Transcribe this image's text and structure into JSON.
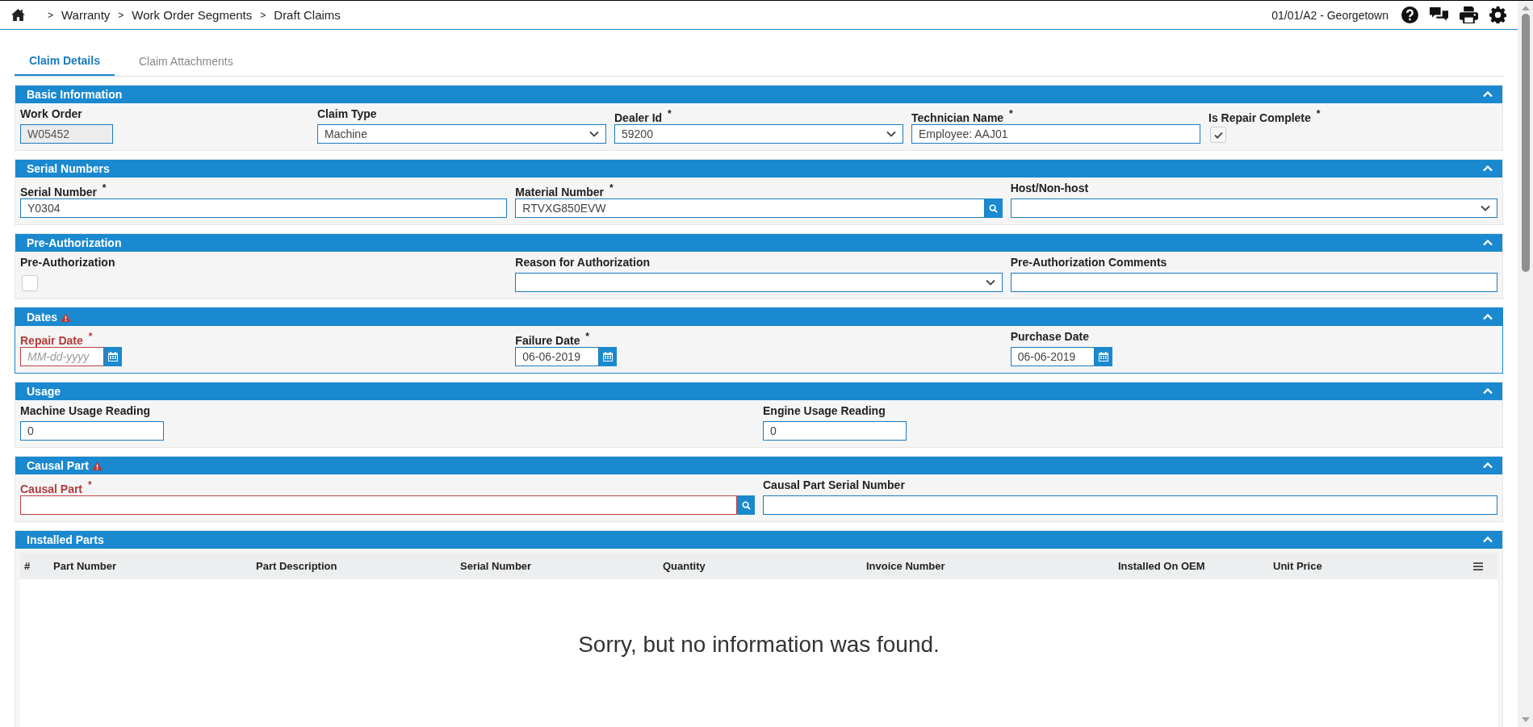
{
  "breadcrumbs": [
    {
      "separator": ">",
      "label": "Warranty"
    },
    {
      "separator": ">",
      "label": "Work Order Segments"
    },
    {
      "separator": ">",
      "label": "Draft Claims"
    }
  ],
  "location": "01/01/A2 - Georgetown",
  "tabs": [
    {
      "label": "Claim Details",
      "selected": true
    },
    {
      "label": "Claim Attachments",
      "selected": false
    }
  ],
  "sections": [
    {
      "title": "Basic Information",
      "kind": "form",
      "warning": false,
      "outlined": false,
      "expanded": true,
      "fields": [
        {
          "kind": "readonly",
          "label": "Work Order",
          "error": false,
          "value": "W05452"
        },
        {
          "kind": "select",
          "label": "Claim Type",
          "error": false,
          "value": "Machine"
        },
        {
          "kind": "select",
          "label": "Dealer Id $^{*}$",
          "error": false,
          "value": "59200"
        },
        {
          "kind": "text",
          "label": "Technician Name $^{*}$",
          "error": false,
          "value": "Employee: AAJ01"
        },
        {
          "kind": "checkbox",
          "label": "Is Repair Complete $^{*}$",
          "error": false,
          "checked": true
        }
      ]
    },
    {
      "title": "Serial Numbers",
      "kind": "form",
      "warning": false,
      "outlined": false,
      "expanded": true,
      "fields": [
        {
          "kind": "text",
          "label": "Serial Number $^{*}$",
          "error": false,
          "value": "Y0304"
        },
        {
          "kind": "lookup",
          "label": "Material Number $^{*}$",
          "error": false,
          "value": "RTVXG850EVW"
        },
        {
          "kind": "select",
          "label": "Host/Non-host",
          "error": false
        }
      ]
    },
    {
      "title": "Pre-Authorization",
      "kind": "form",
      "warning": false,
      "outlined": false,
      "expanded": true,
      "fields": [
        {
          "kind": "checkbox",
          "label": "Pre-Authorization",
          "error": false,
          "checked": false
        },
        {
          "kind": "select",
          "label": "Reason for Authorization",
          "error": false
        },
        {
          "kind": "text",
          "label": "Pre-Authorization Comments",
          "error": false
        }
      ]
    },
    {
      "title": "Dates",
      "kind": "form",
      "warning": true,
      "outlined": true,
      "expanded": true,
      "fields": [
        {
          "kind": "date",
          "label": "Repair Date $^{*}$",
          "error": true,
          "placeholder": "MM-dd-yyyy"
        },
        {
          "kind": "date",
          "label": "Failure Date $^{*}$",
          "error": false,
          "value": "06-06-2019"
        },
        {
          "kind": "date",
          "label": "Purchase Date",
          "error": false,
          "value": "06-06-2019"
        }
      ]
    },
    {
      "title": "Usage",
      "kind": "form",
      "warning": false,
      "outlined": false,
      "expanded": true,
      "fields": [
        {
          "kind": "number",
          "label": "Machine Usage Reading",
          "error": false,
          "value": "0"
        },
        {
          "kind": "number",
          "label": "Engine Usage Reading",
          "error": false,
          "value": "0"
        }
      ]
    },
    {
      "title": "Causal Part",
      "kind": "form",
      "warning": true,
      "outlined": false,
      "expanded": true,
      "fields": [
        {
          "kind": "lookup",
          "label": "Causal Part $^{*}$",
          "error": true
        },
        {
          "kind": "text",
          "label": "Causal Part Serial Number",
          "error": false
        }
      ]
    },
    {
      "title": "Installed Parts",
      "kind": "table",
      "warning": false,
      "outlined": false,
      "expanded": true,
      "columns": [
        "#",
        "Part Number",
        "Part Description",
        "Serial Number",
        "Quantity",
        "Invoice Number",
        "Installed On OEM",
        "Unit Price"
      ],
      "empty_message": "Sorry, but no information was found."
    }
  ]
}
